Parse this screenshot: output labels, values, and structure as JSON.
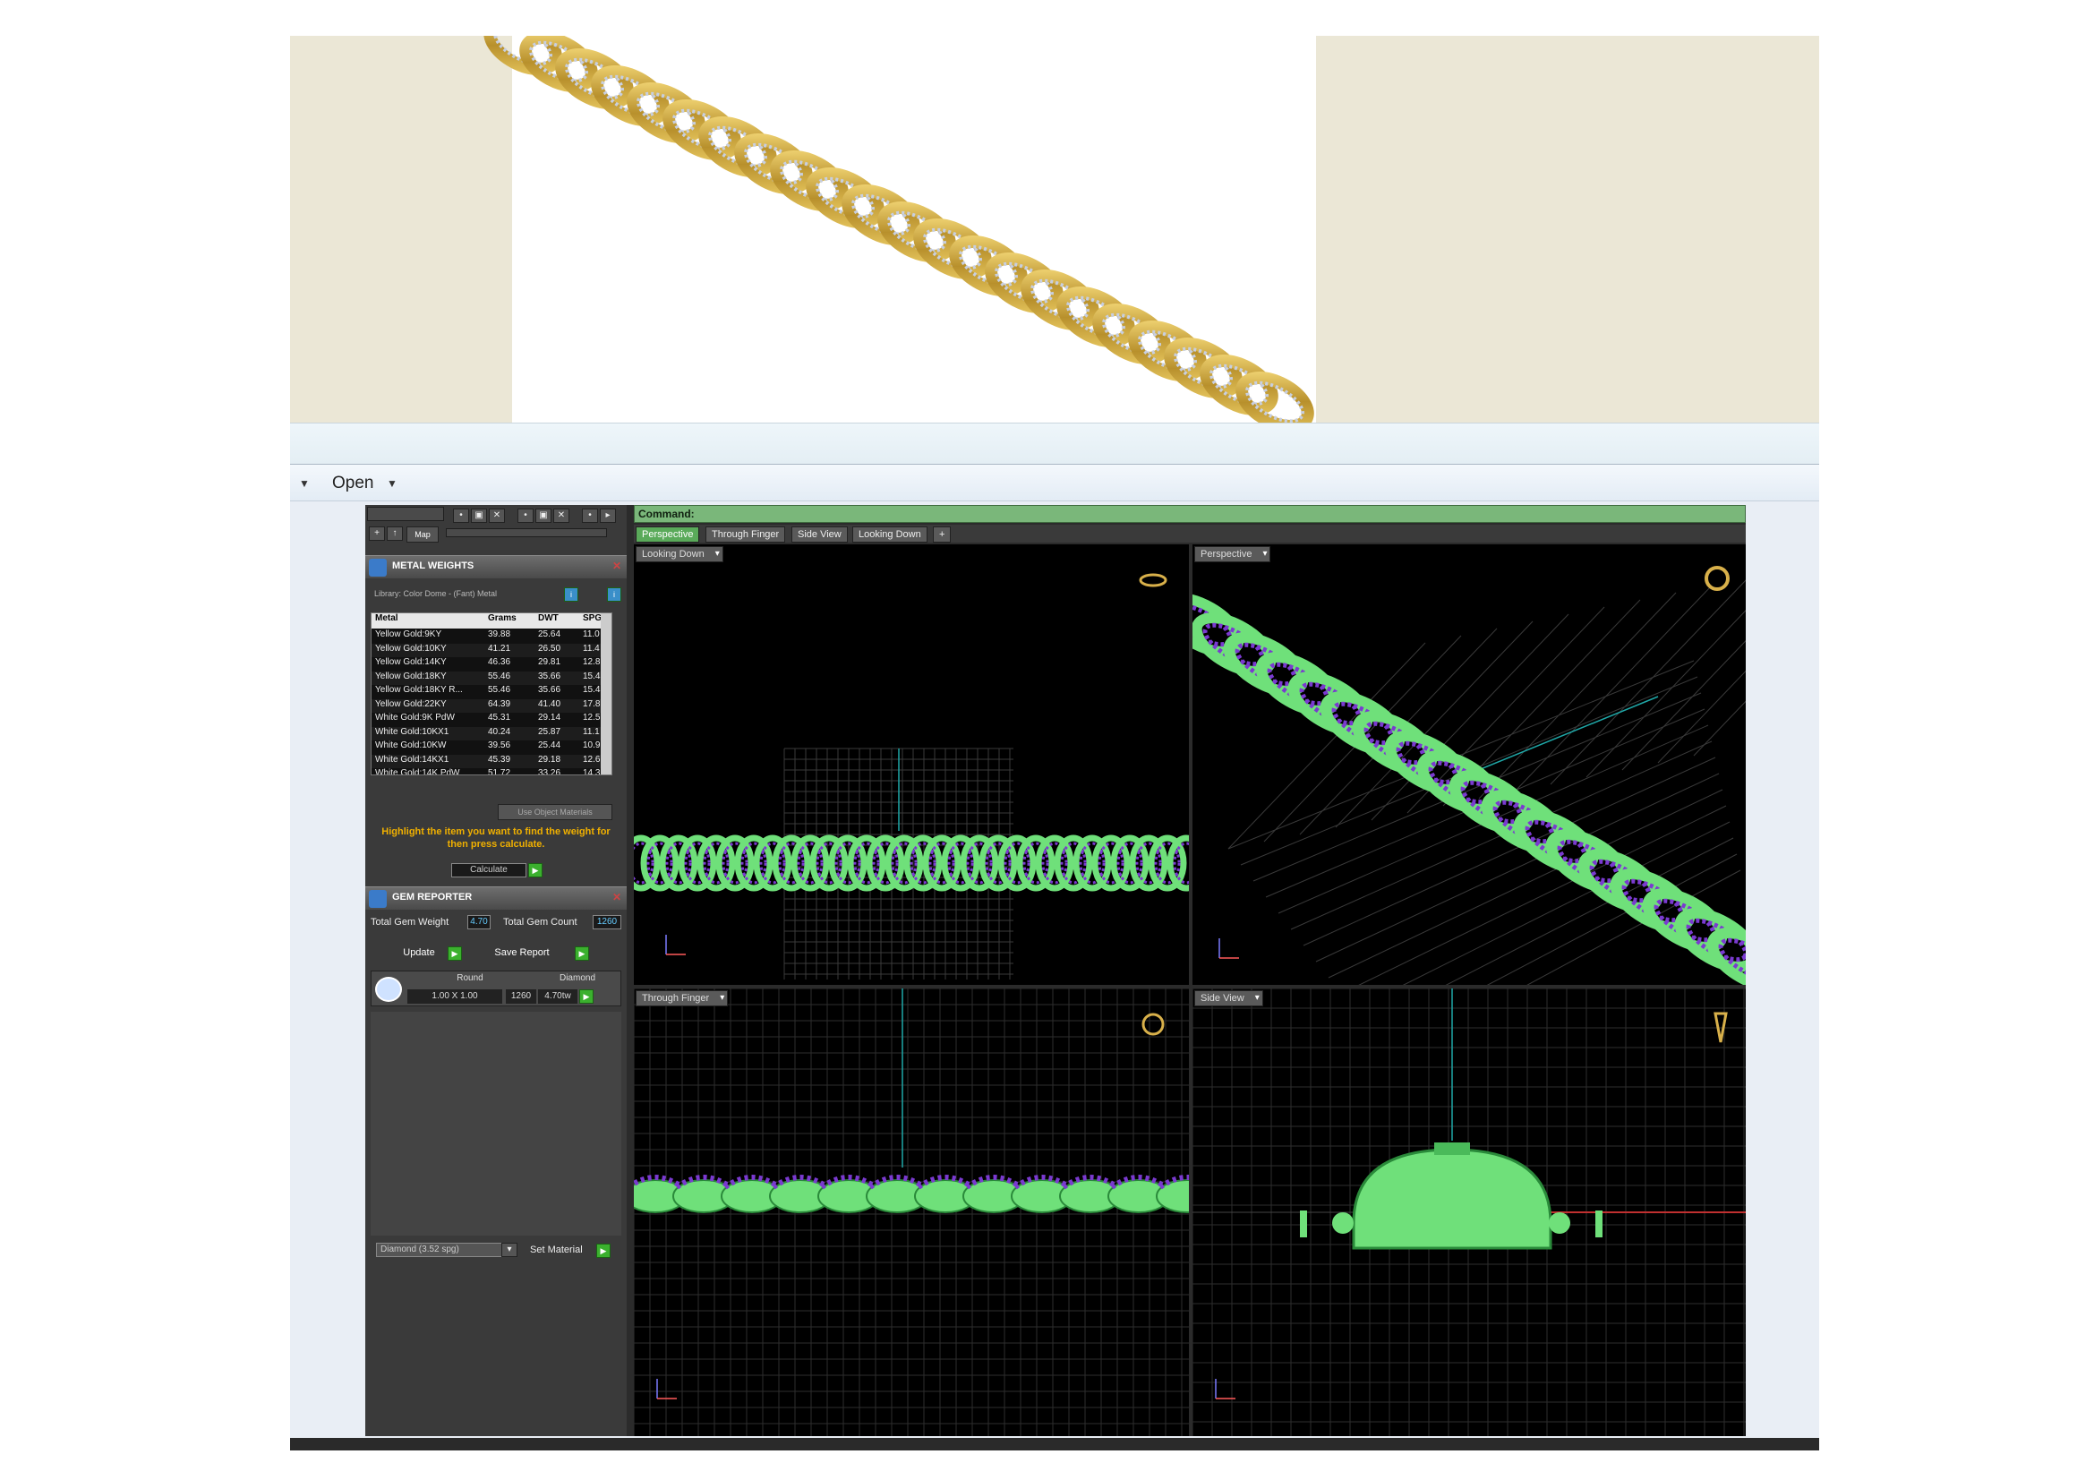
{
  "openbar": {
    "label": "Open"
  },
  "command": {
    "label": "Command:"
  },
  "tabs": [
    "Perspective",
    "Through Finger",
    "Side View",
    "Looking Down",
    "+"
  ],
  "toolbar": {
    "map_label": "Map"
  },
  "metal_weights": {
    "title": "METAL WEIGHTS",
    "library": "Library: Color Dome - (Fant) Metal",
    "headers": [
      "Metal",
      "Grams",
      "DWT",
      "SPG"
    ],
    "rows": [
      [
        "Yellow Gold:9KY",
        "39.88",
        "25.64",
        "11.0"
      ],
      [
        "Yellow Gold:10KY",
        "41.21",
        "26.50",
        "11.4"
      ],
      [
        "Yellow Gold:14KY",
        "46.36",
        "29.81",
        "12.8"
      ],
      [
        "Yellow Gold:18KY",
        "55.46",
        "35.66",
        "15.4"
      ],
      [
        "Yellow Gold:18KY R...",
        "55.46",
        "35.66",
        "15.4"
      ],
      [
        "Yellow Gold:22KY",
        "64.39",
        "41.40",
        "17.8"
      ],
      [
        "White Gold:9K PdW",
        "45.31",
        "29.14",
        "12.5"
      ],
      [
        "White Gold:10KX1",
        "40.24",
        "25.87",
        "11.1"
      ],
      [
        "White Gold:10KW",
        "39.56",
        "25.44",
        "10.9"
      ],
      [
        "White Gold:14KX1",
        "45.39",
        "29.18",
        "12.6"
      ],
      [
        "White Gold:14K PdW",
        "51.72",
        "33.26",
        "14.3"
      ]
    ],
    "use_object_materials": "Use Object Materials",
    "hint": "Highlight the item you want to find the weight for then press calculate.",
    "calculate": "Calculate"
  },
  "gem_reporter": {
    "title": "GEM REPORTER",
    "total_weight_label": "Total Gem Weight",
    "total_weight": "4.70",
    "total_count_label": "Total Gem Count",
    "total_count": "1260",
    "update": "Update",
    "save_report": "Save Report",
    "shape": "Round",
    "material": "Diamond",
    "size": "1.00 X 1.00",
    "count": "1260",
    "ctw": "4.70tw",
    "select_value": "Diamond   (3.52 spg)",
    "set_material": "Set Material"
  },
  "viewports": {
    "top_left": "Looking Down",
    "top_right": "Perspective",
    "bottom_left": "Through Finger",
    "bottom_right": "Side View"
  },
  "colors": {
    "accent_green": "#6fe07a",
    "gem_purple": "#7a3ad0",
    "gold": "#c9a53a"
  }
}
